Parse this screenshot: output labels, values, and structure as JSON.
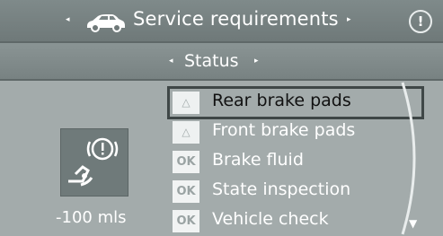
{
  "header": {
    "title": "Service requirements",
    "left_arrow": "◂",
    "right_arrow": "▸",
    "car_icon": "car-icon",
    "info_icon_glyph": "!"
  },
  "subheader": {
    "label": "Status",
    "left_arrow": "◂",
    "right_arrow": "▸"
  },
  "indicator": {
    "symbol": "brake-service-icon",
    "mileage": "-100 mls"
  },
  "items": [
    {
      "label": "Rear brake pads",
      "badge": "△",
      "badge_type": "warning",
      "selected": true
    },
    {
      "label": "Front brake pads",
      "badge": "△",
      "badge_type": "warning",
      "selected": false
    },
    {
      "label": "Brake fluid",
      "badge": "OK",
      "badge_type": "ok",
      "selected": false
    },
    {
      "label": "State inspection",
      "badge": "OK",
      "badge_type": "ok",
      "selected": false
    },
    {
      "label": "Vehicle check",
      "badge": "OK",
      "badge_type": "ok",
      "selected": false
    }
  ],
  "scroll": {
    "down_arrow": "▼"
  }
}
